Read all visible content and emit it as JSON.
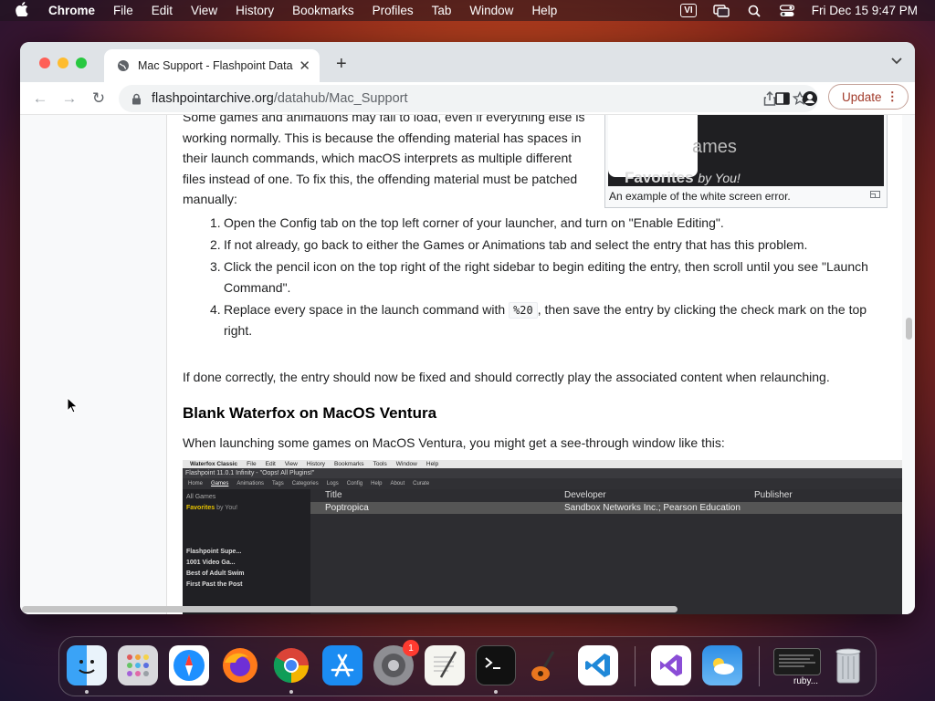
{
  "menubar": {
    "app_name": "Chrome",
    "items": [
      "File",
      "Edit",
      "View",
      "History",
      "Bookmarks",
      "Profiles",
      "Tab",
      "Window",
      "Help"
    ],
    "input_source": "VI",
    "datetime": "Fri Dec 15  9:47 PM"
  },
  "browser": {
    "tab_title": "Mac Support - Flashpoint Data",
    "url_host": "flashpointarchive.org",
    "url_path": "/datahub/Mac_Support",
    "update_label": "Update"
  },
  "article": {
    "para1": "Some games and animations may fail to load, even if everything else is working normally. This is because the offending material has spaces in their launch commands, which macOS interprets as multiple different files instead of one. To fix this, the offending material must be patched manually:",
    "figure_caption": "An example of the white screen error.",
    "figure_text_games": "ames",
    "figure_text_favorites": "Favorites",
    "figure_text_by": "by You!",
    "steps": [
      {
        "num": "1.",
        "text": "Open the Config tab on the top left corner of your launcher, and turn on \"Enable Editing\"."
      },
      {
        "num": "2.",
        "text": "If not already, go back to either the Games or Animations tab and select the entry that has this problem."
      },
      {
        "num": "3.",
        "text": "Click the pencil icon on the top right of the right sidebar to begin editing the entry, then scroll until you see \"Launch Command\"."
      },
      {
        "num": "4.",
        "text_before": "Replace every space in the launch command with ",
        "code": "%20",
        "text_after": ", then save the entry by clicking the check mark on the top right."
      }
    ],
    "para2": "If done correctly, the entry should now be fixed and should correctly play the associated content when relaunching.",
    "heading": "Blank Waterfox on MacOS Ventura",
    "para3": "When launching some games on MacOS Ventura, you might get a see-through window like this:"
  },
  "screenshot": {
    "menu": [
      "Waterfox Classic",
      "File",
      "Edit",
      "View",
      "History",
      "Bookmarks",
      "Tools",
      "Window",
      "Help"
    ],
    "title": "Flashpoint 11.0.1 Infinity - \"Oops! All Plugins!\"",
    "nav": [
      "Home",
      "Games",
      "Animations",
      "Tags",
      "Categories",
      "Logs",
      "Config",
      "Help",
      "About",
      "Curate"
    ],
    "all_games": "All Games",
    "favorites": "Favorites",
    "favorites_by": "by You!",
    "lists": [
      "Flashpoint Supe...",
      "1001 Video Ga...",
      "Best of Adult Swim",
      "First Past the Post"
    ],
    "columns": [
      "Title",
      "Developer",
      "Publisher"
    ],
    "row": {
      "title": "Poptropica",
      "developer": "Sandbox Networks Inc.; Pearson Education",
      "publisher": ""
    }
  },
  "dock": {
    "apps": [
      "Finder",
      "Launchpad",
      "Safari",
      "Firefox",
      "Chrome",
      "App Store",
      "System Settings",
      "TextEdit",
      "Terminal",
      "GarageBand",
      "Visual Studio Code",
      "Visual Studio",
      "Weather",
      "ruby",
      "Trash"
    ],
    "settings_badge": "1",
    "ruby_label": "ruby..."
  }
}
